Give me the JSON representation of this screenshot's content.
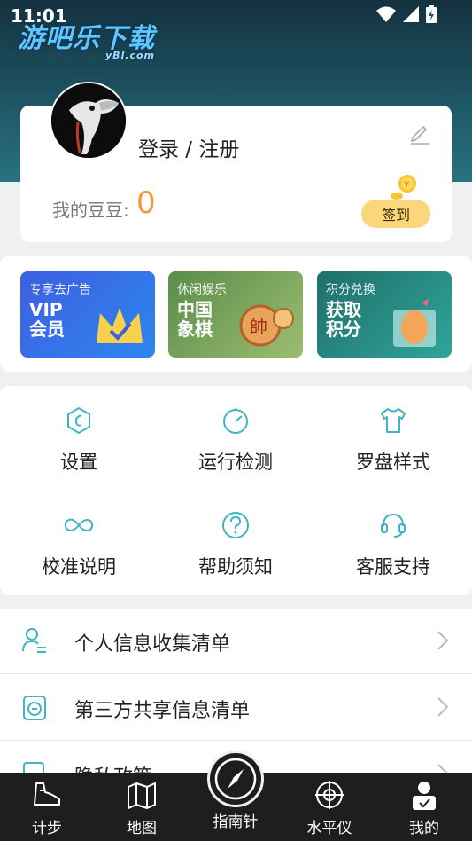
{
  "status": {
    "time": "11:01"
  },
  "watermark": {
    "title": "游吧乐下载",
    "sub": "yBl.com"
  },
  "profile": {
    "login_label": "登录 / 注册",
    "beans_label": "我的豆豆:",
    "beans_count": "0",
    "checkin_label": "签到"
  },
  "promos": [
    {
      "tag": "专享去广告",
      "title_line1": "VIP",
      "title_line2": "会员"
    },
    {
      "tag": "休闲娱乐",
      "title_line1": "中国",
      "title_line2": "象棋"
    },
    {
      "tag": "积分兑换",
      "title_line1": "获取",
      "title_line2": "积分"
    }
  ],
  "grid": [
    {
      "label": "设置",
      "icon": "hexagon-settings-icon"
    },
    {
      "label": "运行检测",
      "icon": "gauge-icon"
    },
    {
      "label": "罗盘样式",
      "icon": "tshirt-icon"
    },
    {
      "label": "校准说明",
      "icon": "infinity-icon"
    },
    {
      "label": "帮助须知",
      "icon": "question-icon"
    },
    {
      "label": "客服支持",
      "icon": "headset-icon"
    }
  ],
  "list": [
    {
      "label": "个人信息收集清单",
      "icon": "person-list-icon"
    },
    {
      "label": "第三方共享信息清单",
      "icon": "share-doc-icon"
    },
    {
      "label": "隐私政策",
      "icon": "privacy-doc-icon"
    }
  ],
  "nav": [
    {
      "label": "计步",
      "icon": "shoe-icon"
    },
    {
      "label": "地图",
      "icon": "map-icon"
    },
    {
      "label": "指南针",
      "icon": "compass-icon"
    },
    {
      "label": "水平仪",
      "icon": "level-icon"
    },
    {
      "label": "我的",
      "icon": "user-icon"
    }
  ],
  "colors": {
    "accent": "#3fb5c4",
    "beans": "#f5973a",
    "checkin": "#fbd67a",
    "header": "#1e5564"
  }
}
